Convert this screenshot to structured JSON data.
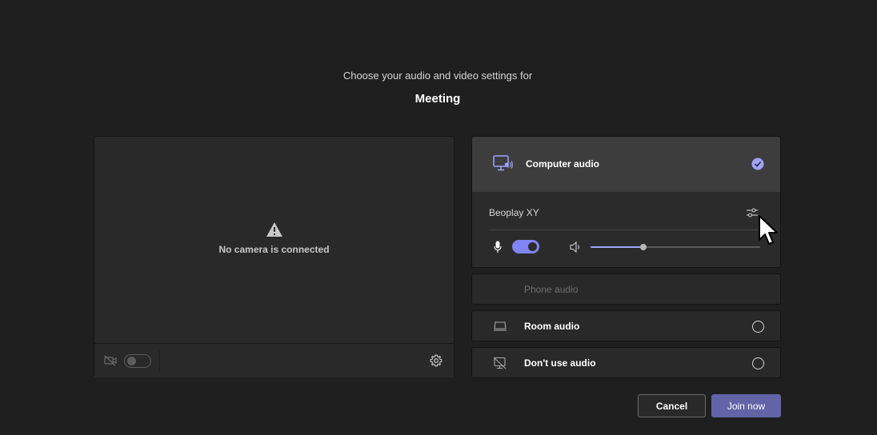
{
  "header": {
    "subtitle": "Choose your audio and video settings for",
    "title": "Meeting"
  },
  "video": {
    "status_text": "No camera is connected",
    "camera_toggle_state": "off",
    "icons": [
      "warning-icon",
      "camera-off-icon",
      "gear-icon"
    ]
  },
  "audio": {
    "computer_audio": {
      "label": "Computer audio",
      "selected": true,
      "device_name": "Beoplay XY",
      "mic_on": true,
      "volume_level": 0.31
    },
    "options": [
      {
        "label": "Phone audio",
        "disabled": true
      },
      {
        "label": "Room audio",
        "disabled": false,
        "selected": false
      },
      {
        "label": "Don't use audio",
        "disabled": false,
        "selected": false
      }
    ]
  },
  "actions": {
    "cancel_label": "Cancel",
    "join_label": "Join now"
  },
  "colors": {
    "accent": "#7f85f5",
    "join_button": "#6264a7",
    "background": "#1f1f1f"
  }
}
